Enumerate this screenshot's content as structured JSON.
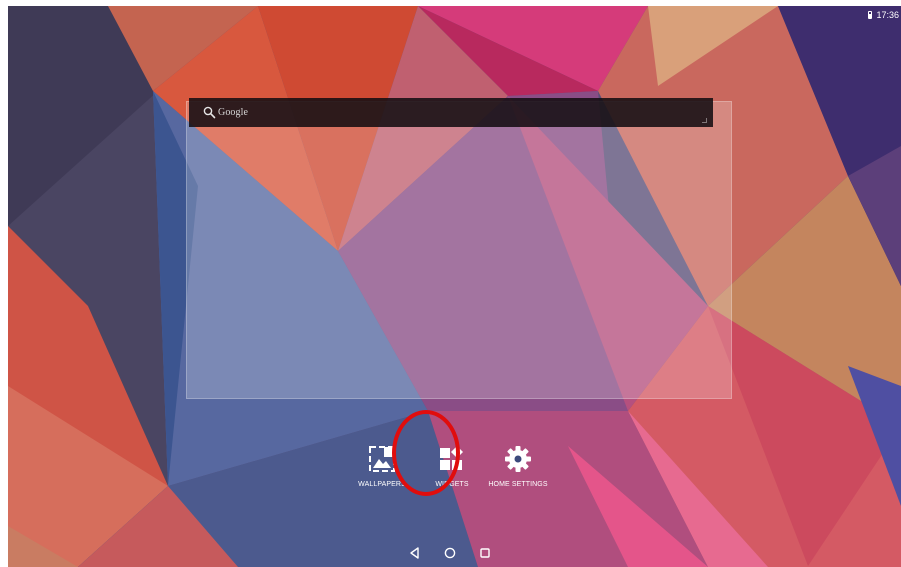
{
  "status_bar": {
    "time": "17:36",
    "battery_icon": "battery-icon"
  },
  "search": {
    "placeholder": "Google",
    "icon": "search-icon"
  },
  "overview_options": {
    "wallpapers": {
      "label": "WALLPAPERS",
      "icon": "wallpaper-icon"
    },
    "widgets": {
      "label": "WIDGETS",
      "icon": "widgets-icon"
    },
    "home_settings": {
      "label": "HOME SETTINGS",
      "icon": "gear-icon"
    }
  },
  "navigation": {
    "back_icon": "back-icon",
    "home_icon": "home-icon",
    "recents_icon": "recents-icon"
  },
  "colors": {
    "highlight": "#e00d0d",
    "search_bar": "#140e12"
  }
}
